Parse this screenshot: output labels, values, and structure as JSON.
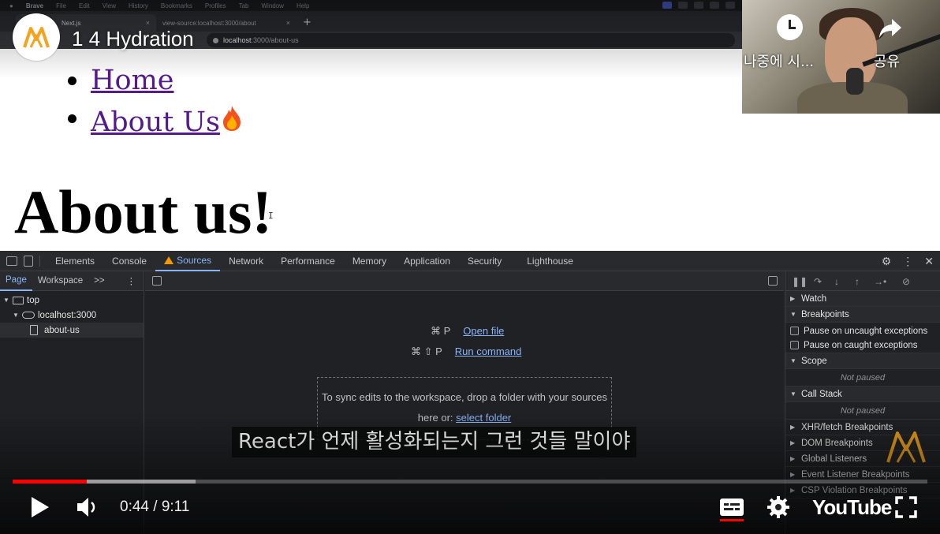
{
  "macos_menu": {
    "items": [
      "Brave",
      "File",
      "Edit",
      "View",
      "History",
      "Bookmarks",
      "Profiles",
      "Tab",
      "Window",
      "Help"
    ]
  },
  "browser": {
    "tabs": [
      {
        "title": "Next.js",
        "active": true
      },
      {
        "title": "view-source:localhost:3000/about",
        "active": false
      }
    ],
    "new_tab": "+",
    "url_host": "localhost",
    "url_path": ":3000/about-us"
  },
  "page": {
    "nav_links": [
      {
        "label": "Home"
      },
      {
        "label": "About Us"
      }
    ],
    "heading": "About us!",
    "text_cursor": "I"
  },
  "video": {
    "title": "1 4 Hydration",
    "watch_later_label": "나중에 시...",
    "share_label": "공유",
    "subtitle": "React가 언제 활성화되는지 그런 것들 말이야",
    "time_current": "0:44",
    "time_total": "9:11",
    "time_separator": " / ",
    "progress_played": 0.081,
    "progress_buffered": 0.2,
    "logo": "YouTube",
    "accent": "#ff0000"
  },
  "devtools": {
    "tabs": [
      "Elements",
      "Console",
      "Sources",
      "Network",
      "Performance",
      "Memory",
      "Application",
      "Security",
      "Lighthouse"
    ],
    "active_tab": "Sources",
    "left_tabs": [
      "Page",
      "Workspace"
    ],
    "more": ">>",
    "tree": {
      "top": "top",
      "host": "localhost:3000",
      "file": "about-us"
    },
    "shortcuts": [
      {
        "keys": "⌘ P",
        "label": "Open file"
      },
      {
        "keys": "⌘ ⇧ P",
        "label": "Run command"
      }
    ],
    "dropzone_text": "To sync edits to the workspace, drop a folder with your sources here or:",
    "dropzone_link": "select folder",
    "right_sections": {
      "watch": "Watch",
      "breakpoints": "Breakpoints",
      "pause_uncaught": "Pause on uncaught exceptions",
      "pause_caught": "Pause on caught exceptions",
      "scope": "Scope",
      "not_paused": "Not paused",
      "call_stack": "Call Stack",
      "xhr": "XHR/fetch Breakpoints",
      "dom": "DOM Breakpoints",
      "global": "Global Listeners",
      "event": "Event Listener Breakpoints",
      "csp": "CSP Violation Breakpoints"
    }
  }
}
